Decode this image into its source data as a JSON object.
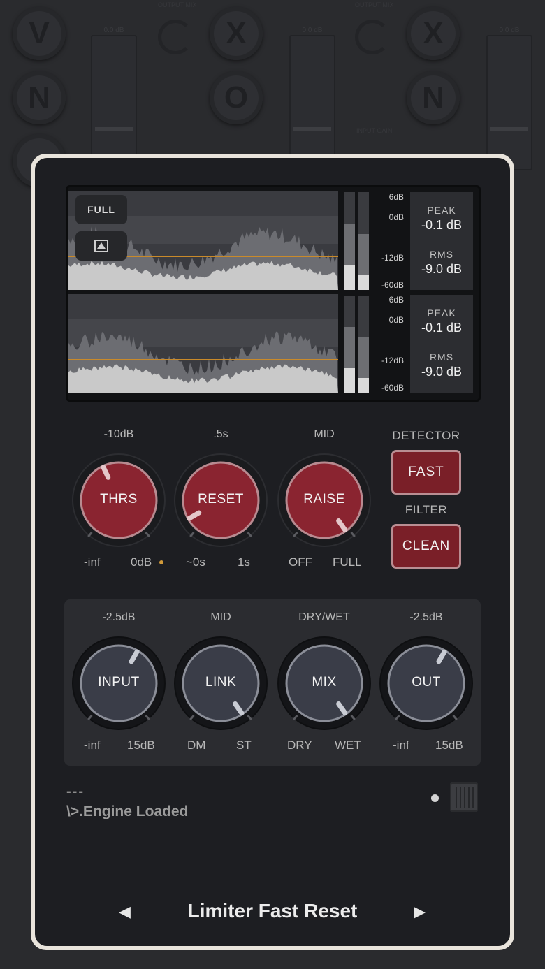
{
  "background": {
    "buttons": [
      "V",
      "N",
      "X",
      "O",
      "X",
      "N"
    ],
    "labels": [
      "OUTPUT MIX",
      "OUTPUT MIX",
      "0.0 dB",
      "0.0 dB",
      "INPUT GAIN",
      "0.0 dB"
    ]
  },
  "meter": {
    "mode_button": "FULL",
    "scale": [
      "6dB",
      "0dB",
      "-12dB",
      "-60dB"
    ],
    "channels": [
      {
        "peak_label": "PEAK",
        "peak_value": "-0.1 dB",
        "rms_label": "RMS",
        "rms_value": "-9.0 dB",
        "bar_left_level": 0.26,
        "bar_right_level": 0.16
      },
      {
        "peak_label": "PEAK",
        "peak_value": "-0.1 dB",
        "rms_label": "RMS",
        "rms_value": "-9.0 dB",
        "bar_left_level": 0.26,
        "bar_right_level": 0.16
      }
    ]
  },
  "limiter": {
    "knobs": [
      {
        "name": "THRS",
        "value": "-10dB",
        "min": "-inf",
        "max": "0dB"
      },
      {
        "name": "RESET",
        "value": ".5s",
        "min": "~0s",
        "max": "1s"
      },
      {
        "name": "RAISE",
        "value": "MID",
        "min": "OFF",
        "max": "FULL"
      }
    ],
    "detector_label": "DETECTOR",
    "detector_value": "FAST",
    "filter_label": "FILTER",
    "filter_value": "CLEAN"
  },
  "io": {
    "knobs": [
      {
        "name": "INPUT",
        "value": "-2.5dB",
        "min": "-inf",
        "max": "15dB"
      },
      {
        "name": "LINK",
        "value": "MID",
        "min": "DM",
        "max": "ST"
      },
      {
        "name": "MIX",
        "value": "DRY/WET",
        "min": "DRY",
        "max": "WET"
      },
      {
        "name": "OUT",
        "value": "-2.5dB",
        "min": "-inf",
        "max": "15dB"
      }
    ]
  },
  "status": {
    "dashes": "---",
    "message": "\\>.Engine Loaded"
  },
  "preset": {
    "name": "Limiter Fast Reset",
    "prev": "◀",
    "next": "▶"
  },
  "colors": {
    "knob_red": "#8a2430",
    "knob_blue": "#3a3d48",
    "threshold_line": "#c98a2a",
    "button_red": "#7a1f28"
  }
}
